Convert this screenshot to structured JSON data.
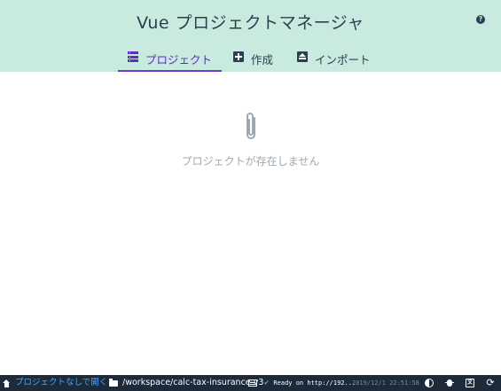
{
  "header": {
    "title": "Vue プロジェクトマネージャ",
    "help_icon": "?"
  },
  "tabs": [
    {
      "label": "プロジェクト",
      "icon": "list-icon",
      "active": true
    },
    {
      "label": "作成",
      "icon": "plus-box-icon",
      "active": false
    },
    {
      "label": "インポート",
      "icon": "import-icon",
      "active": false
    }
  ],
  "empty_state": {
    "icon": "paperclip-icon",
    "message": "プロジェクトが存在しません"
  },
  "statusbar": {
    "home_label": "プロジェクトなしで開く",
    "folder_path": "/workspace/calc-tax-insurance-v3",
    "log_message": "Ready on http://192...",
    "datetime": "2019/12/1 22:51:58",
    "translate_glyph": "文",
    "refresh_glyph": "⟳"
  },
  "colors": {
    "header_bg": "#c9eadf",
    "accent": "#5a2fbf",
    "statusbar_bg": "#1c2a3a",
    "success": "#42b983"
  }
}
